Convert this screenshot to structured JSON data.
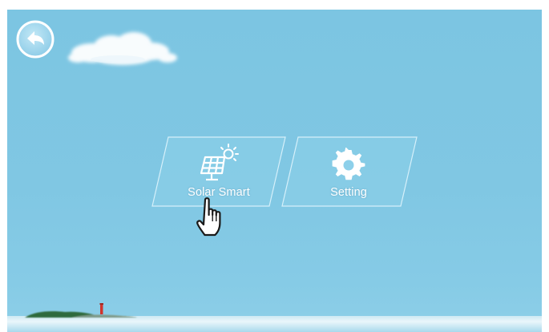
{
  "menu": {
    "tiles": [
      {
        "label": "Solar Smart",
        "icon": "solar-panel-sun-icon"
      },
      {
        "label": "Setting",
        "icon": "gear-icon"
      }
    ]
  },
  "navigation": {
    "back_icon": "back-arrow-icon"
  },
  "colors": {
    "sky": "#80c7e3",
    "tile_fill": "#8dd0ea",
    "tile_border": "#d6f0fa",
    "text": "#ffffff",
    "back_button": "#a8dbef"
  }
}
